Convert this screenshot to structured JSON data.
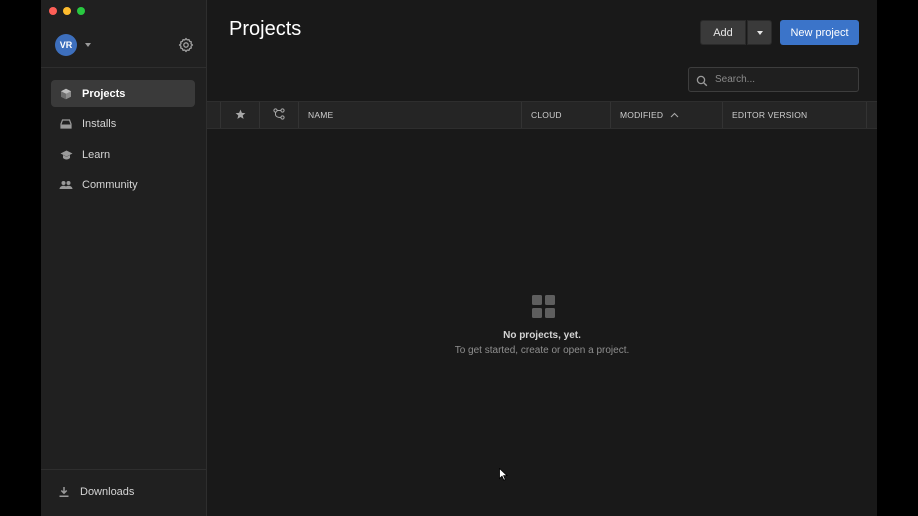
{
  "user": {
    "initials": "VR"
  },
  "sidebar": {
    "items": [
      {
        "label": "Projects",
        "icon": "cube-icon",
        "active": true
      },
      {
        "label": "Installs",
        "icon": "drive-icon",
        "active": false
      },
      {
        "label": "Learn",
        "icon": "graduation-cap-icon",
        "active": false
      },
      {
        "label": "Community",
        "icon": "people-icon",
        "active": false
      }
    ],
    "downloads_label": "Downloads"
  },
  "header": {
    "title": "Projects",
    "add_label": "Add",
    "new_project_label": "New project"
  },
  "search": {
    "placeholder": "Search...",
    "value": ""
  },
  "table": {
    "columns": {
      "star": "star-icon",
      "branch": "branch-icon",
      "name": "NAME",
      "cloud": "CLOUD",
      "modified": "MODIFIED",
      "editor_version": "EDITOR VERSION"
    },
    "sort": {
      "column": "MODIFIED",
      "direction": "ascending"
    }
  },
  "empty_state": {
    "title": "No projects, yet.",
    "subtitle": "To get started, create or open a project."
  },
  "colors": {
    "accent": "#3b74c9",
    "sidebar_bg": "#202020",
    "main_bg": "#191919"
  }
}
